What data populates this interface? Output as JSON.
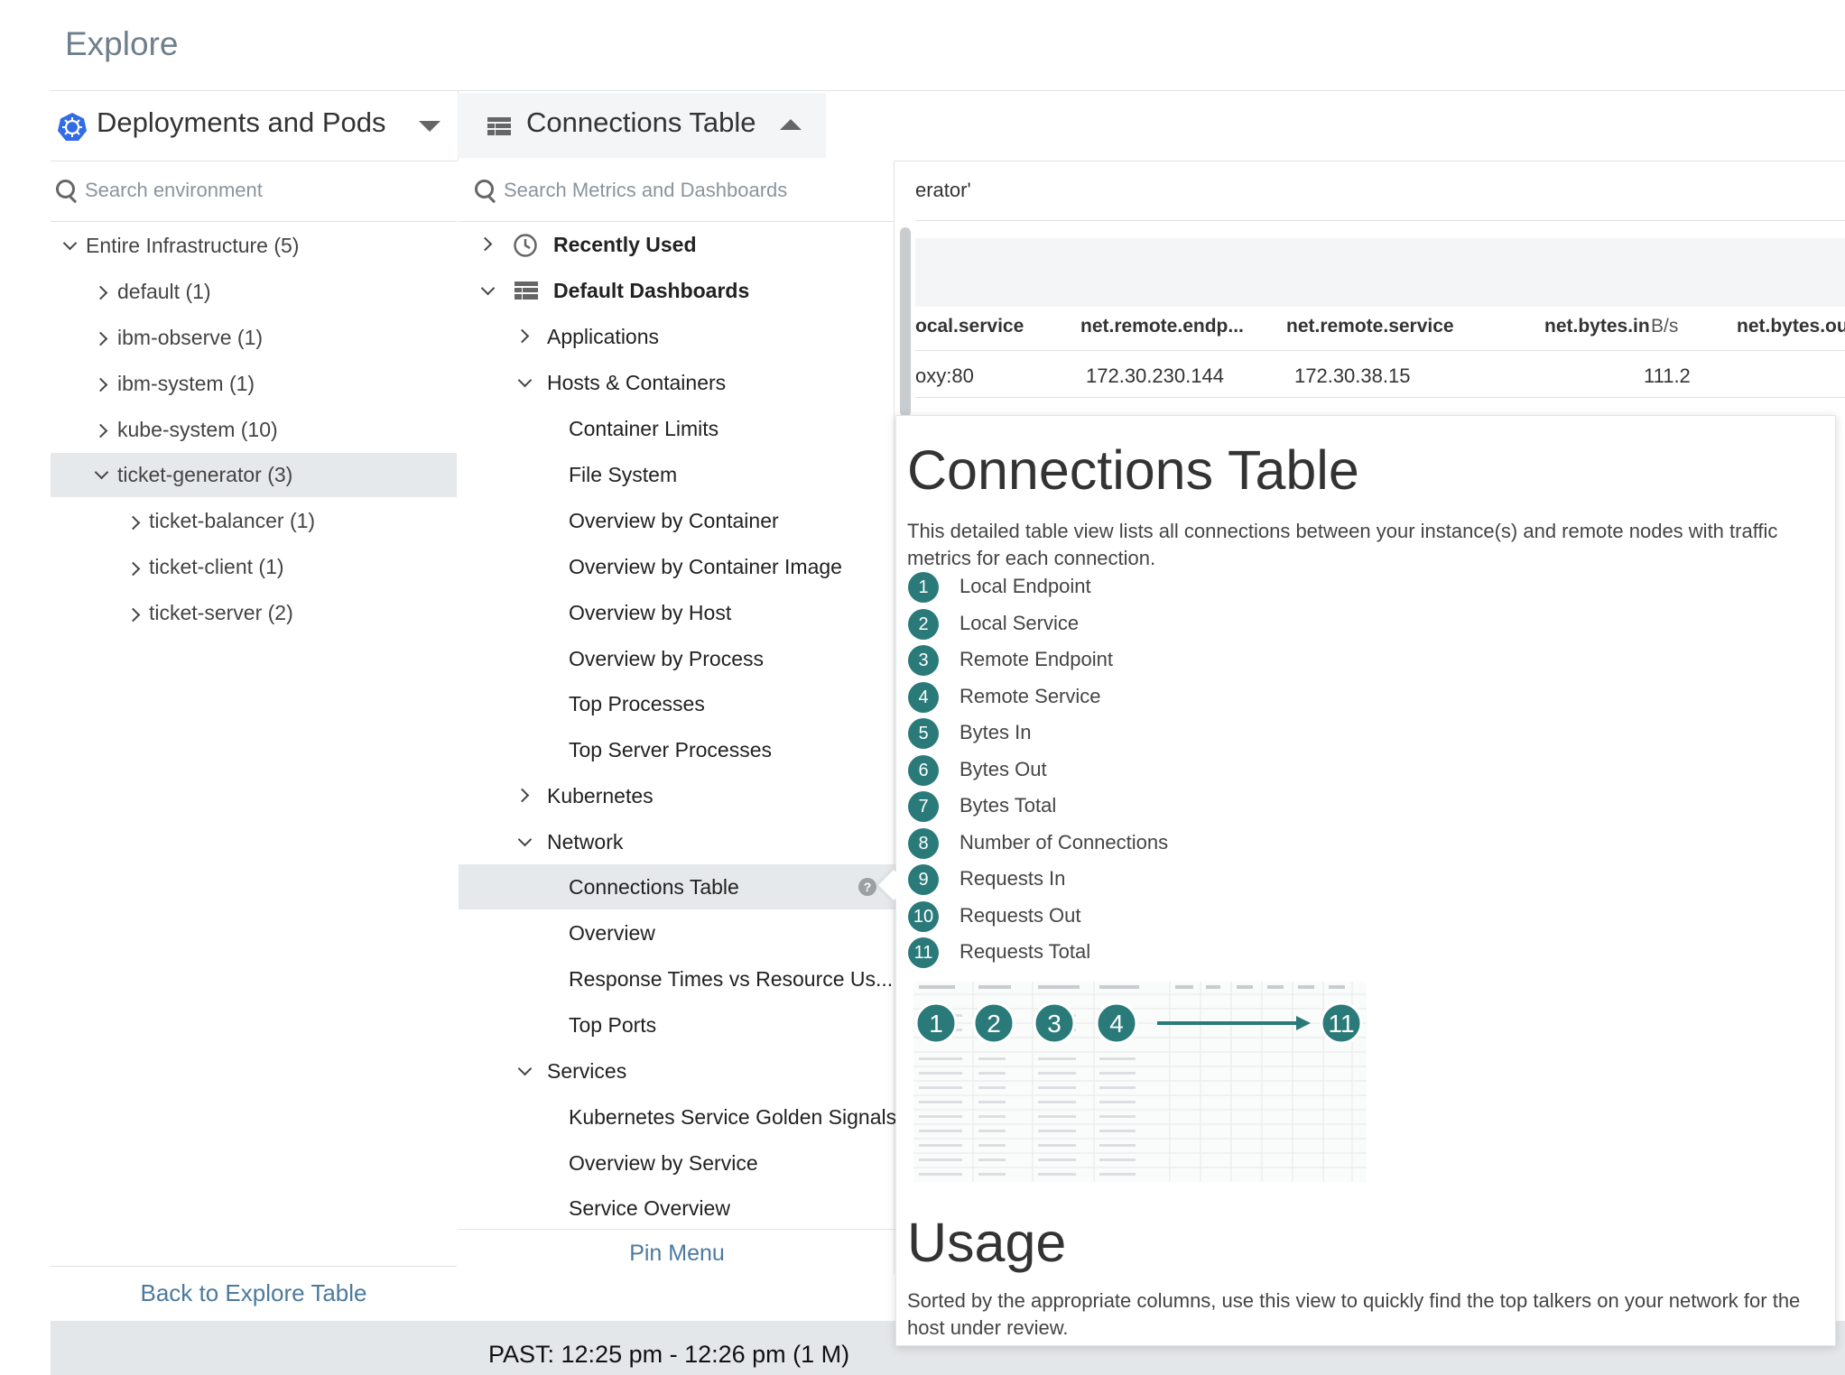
{
  "app_title": "Explore",
  "scope": {
    "title": "Deployments and Pods",
    "search_placeholder": "Search environment"
  },
  "tree": {
    "items": [
      {
        "label": "Entire Infrastructure (5)"
      },
      {
        "label": "default (1)"
      },
      {
        "label": "ibm-observe (1)"
      },
      {
        "label": "ibm-system (1)"
      },
      {
        "label": "kube-system (10)"
      },
      {
        "label": "ticket-generator (3)"
      },
      {
        "label": "ticket-balancer (1)"
      },
      {
        "label": "ticket-client (1)"
      },
      {
        "label": "ticket-server (2)"
      }
    ],
    "back_label": "Back to Explore Table"
  },
  "menu": {
    "title": "Connections Table",
    "search_placeholder": "Search Metrics and Dashboards",
    "items": [
      {
        "label": "Recently Used"
      },
      {
        "label": "Default Dashboards"
      },
      {
        "label": "Applications"
      },
      {
        "label": "Hosts & Containers"
      },
      {
        "label": "Container Limits"
      },
      {
        "label": "File System"
      },
      {
        "label": "Overview by Container"
      },
      {
        "label": "Overview by Container Image"
      },
      {
        "label": "Overview by Host"
      },
      {
        "label": "Overview by Process"
      },
      {
        "label": "Top Processes"
      },
      {
        "label": "Top Server Processes"
      },
      {
        "label": "Kubernetes"
      },
      {
        "label": "Network"
      },
      {
        "label": "Connections Table"
      },
      {
        "label": "Overview"
      },
      {
        "label": "Response Times vs Resource Us..."
      },
      {
        "label": "Top Ports"
      },
      {
        "label": "Services"
      },
      {
        "label": "Kubernetes Service Golden Signals"
      },
      {
        "label": "Overview by Service"
      },
      {
        "label": "Service Overview"
      }
    ],
    "help_glyph": "?",
    "pin_label": "Pin Menu"
  },
  "background_table": {
    "filter_fragment": "erator'",
    "headers": [
      "ocal.service",
      "net.remote.endp...",
      "net.remote.service",
      "net.bytes.in",
      "B/s",
      "net.bytes.ou"
    ],
    "row": [
      "oxy:80",
      "172.30.230.144",
      "172.30.38.15",
      "111.2"
    ]
  },
  "time_bar": {
    "range": "PAST: 12:25 pm - 12:26 pm (1 M)"
  },
  "tooltip": {
    "title": "Connections Table",
    "description": "This detailed table view lists all connections between your instance(s) and remote nodes with traffic metrics for each connection.",
    "items": [
      {
        "num": "1",
        "label": "Local Endpoint"
      },
      {
        "num": "2",
        "label": "Local Service"
      },
      {
        "num": "3",
        "label": "Remote Endpoint"
      },
      {
        "num": "4",
        "label": "Remote Service"
      },
      {
        "num": "5",
        "label": "Bytes In"
      },
      {
        "num": "6",
        "label": "Bytes Out"
      },
      {
        "num": "7",
        "label": "Bytes Total"
      },
      {
        "num": "8",
        "label": "Number of Connections"
      },
      {
        "num": "9",
        "label": "Requests In"
      },
      {
        "num": "10",
        "label": "Requests Out"
      },
      {
        "num": "11",
        "label": "Requests Total"
      }
    ],
    "image_badges": [
      "1",
      "2",
      "3",
      "4",
      "11"
    ],
    "usage_title": "Usage",
    "usage_text": "Sorted by the appropriate columns, use this view to quickly find the top talkers on your network for the host under review."
  },
  "colors": {
    "accent": "#4c7a9e",
    "badge": "#2b7a7a",
    "k8s": "#326ce5",
    "selected_bg": "#e6e9eb"
  }
}
